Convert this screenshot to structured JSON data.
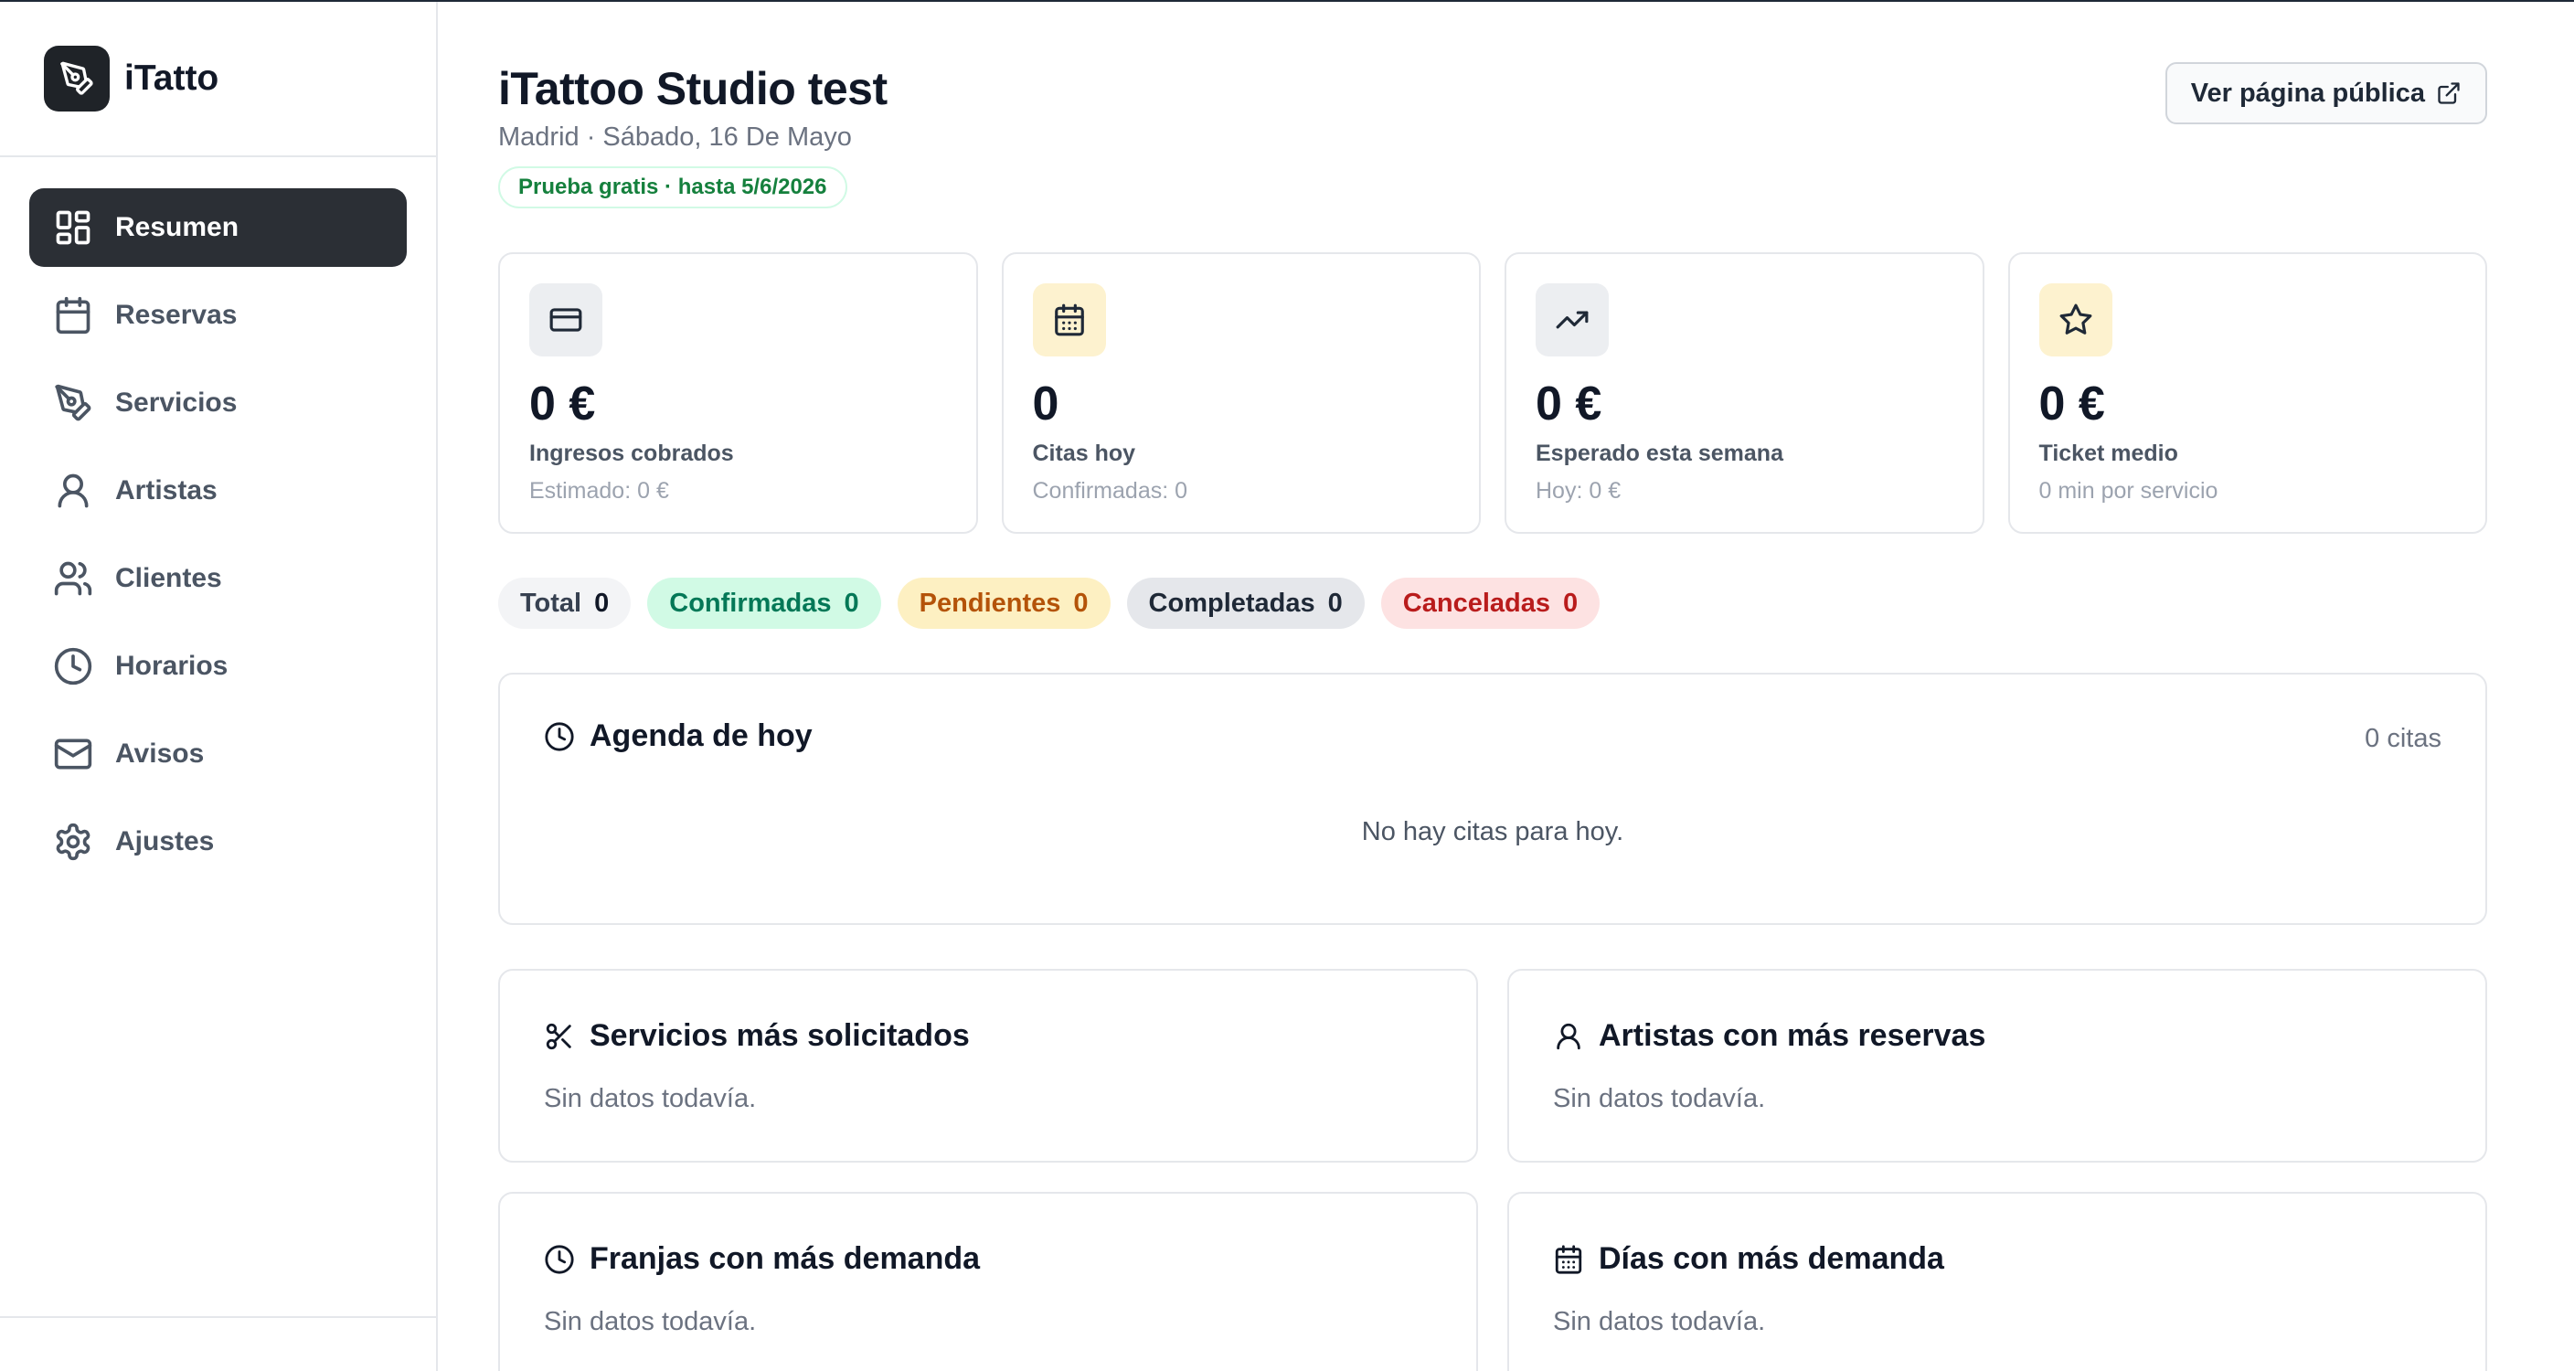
{
  "brand": {
    "name": "iTatto",
    "logo_icon": "pen-nib-icon"
  },
  "sidebar": {
    "items": [
      {
        "label": "Resumen",
        "icon": "dashboard-icon",
        "active": true
      },
      {
        "label": "Reservas",
        "icon": "calendar-icon",
        "active": false
      },
      {
        "label": "Servicios",
        "icon": "pen-nib-icon",
        "active": false
      },
      {
        "label": "Artistas",
        "icon": "user-icon",
        "active": false
      },
      {
        "label": "Clientes",
        "icon": "users-icon",
        "active": false
      },
      {
        "label": "Horarios",
        "icon": "clock-icon",
        "active": false
      },
      {
        "label": "Avisos",
        "icon": "mail-icon",
        "active": false
      },
      {
        "label": "Ajustes",
        "icon": "gear-icon",
        "active": false
      }
    ]
  },
  "header": {
    "title": "iTattoo Studio test",
    "subtitle": "Madrid · Sábado, 16 De Mayo",
    "trial_badge": "Prueba gratis · hasta 5/6/2026",
    "public_button": "Ver página pública"
  },
  "stats": [
    {
      "value": "0 €",
      "label": "Ingresos cobrados",
      "sub": "Estimado: 0 €",
      "icon": "credit-card-icon"
    },
    {
      "value": "0",
      "label": "Citas hoy",
      "sub": "Confirmadas: 0",
      "icon": "calendar-icon"
    },
    {
      "value": "0 €",
      "label": "Esperado esta semana",
      "sub": "Hoy: 0 €",
      "icon": "trending-up-icon"
    },
    {
      "value": "0 €",
      "label": "Ticket medio",
      "sub": "0 min por servicio",
      "icon": "star-icon"
    }
  ],
  "status_pills": [
    {
      "label": "Total",
      "count": "0"
    },
    {
      "label": "Confirmadas",
      "count": "0"
    },
    {
      "label": "Pendientes",
      "count": "0"
    },
    {
      "label": "Completadas",
      "count": "0"
    },
    {
      "label": "Canceladas",
      "count": "0"
    }
  ],
  "agenda": {
    "title": "Agenda de hoy",
    "count": "0 citas",
    "empty": "No hay citas para hoy."
  },
  "cards": [
    {
      "title": "Servicios más solicitados",
      "empty": "Sin datos todavía.",
      "icon": "scissors-icon"
    },
    {
      "title": "Artistas con más reservas",
      "empty": "Sin datos todavía.",
      "icon": "user-icon"
    },
    {
      "title": "Franjas con más demanda",
      "empty": "Sin datos todavía.",
      "icon": "clock-icon"
    },
    {
      "title": "Días con más demanda",
      "empty": "Sin datos todavía.",
      "icon": "calendar-icon"
    }
  ],
  "colors": {
    "active_nav_bg": "#2b2f35",
    "confirmed": "#047857",
    "pending": "#b45309",
    "cancelled": "#b91c1c",
    "trial_green": "#15803d"
  }
}
